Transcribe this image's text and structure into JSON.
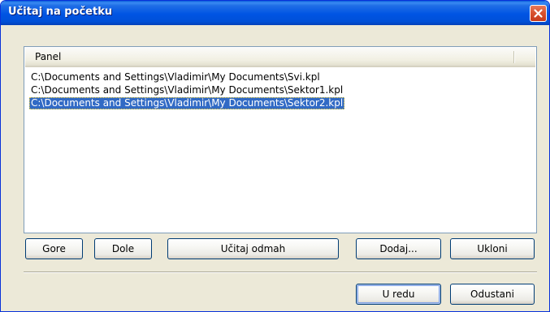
{
  "window": {
    "title": "Učitaj na početku",
    "close_icon": "close-icon"
  },
  "list": {
    "column_header": "Panel",
    "items": [
      "C:\\Documents and Settings\\Vladimir\\My Documents\\Svi.kpl",
      "C:\\Documents and Settings\\Vladimir\\My Documents\\Sektor1.kpl",
      "C:\\Documents and Settings\\Vladimir\\My Documents\\Sektor2.kpl"
    ],
    "selected_index": 2
  },
  "buttons": {
    "up": "Gore",
    "down": "Dole",
    "load_now": "Učitaj odmah",
    "add": "Dodaj...",
    "remove": "Ukloni",
    "ok": "U redu",
    "cancel": "Odustani"
  },
  "colors": {
    "titlebar": "#0054e3",
    "selection": "#316ac5",
    "dialog_face": "#ece9d8",
    "close_button": "#d9532f"
  }
}
